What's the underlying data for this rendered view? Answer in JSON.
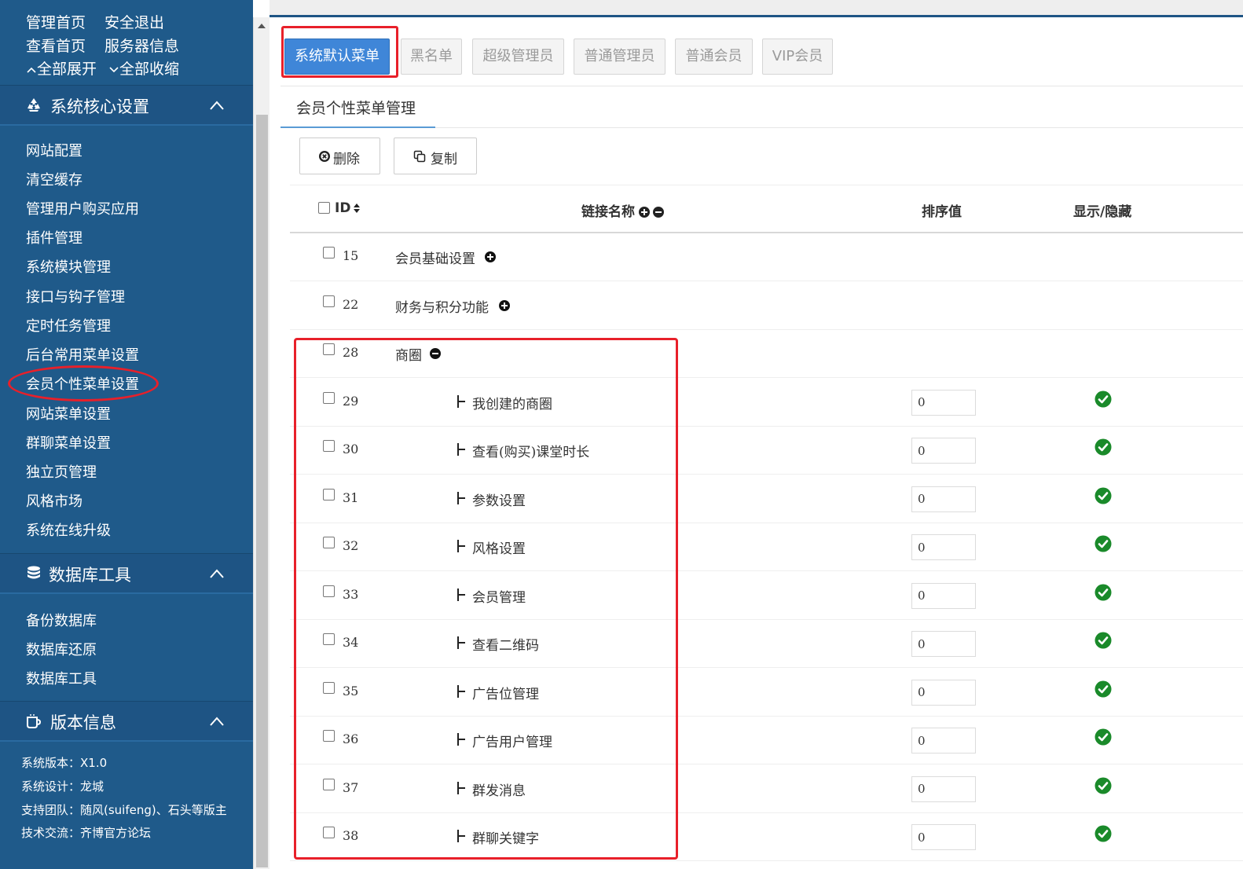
{
  "sidebar": {
    "top_links": [
      "管理首页",
      "安全退出",
      "查看首页",
      "服务器信息"
    ],
    "expand_all": "全部展开",
    "collapse_all": "全部收缩",
    "sections": [
      {
        "title": "系统核心设置",
        "icon": "recycle-icon",
        "items": [
          "网站配置",
          "清空缓存",
          "管理用户购买应用",
          "插件管理",
          "系统模块管理",
          "接口与钩子管理",
          "定时任务管理",
          "后台常用菜单设置",
          "会员个性菜单设置",
          "网站菜单设置",
          "群聊菜单设置",
          "独立页管理",
          "风格市场",
          "系统在线升级"
        ]
      },
      {
        "title": "数据库工具",
        "icon": "database-icon",
        "items": [
          "备份数据库",
          "数据库还原",
          "数据库工具"
        ]
      },
      {
        "title": "版本信息",
        "icon": "coffee-cup-icon",
        "lines": [
          "系统版本：X1.0",
          "系统设计：龙城",
          "支持团队：随风(suifeng)、石头等版主",
          "技术交流：齐博官方论坛"
        ]
      }
    ],
    "active_item": "会员个性菜单设置"
  },
  "role_tabs": [
    "系统默认菜单",
    "黑名单",
    "超级管理员",
    "普通管理员",
    "普通会员",
    "VIP会员"
  ],
  "active_tab": "系统默认菜单",
  "panel_title": "会员个性菜单管理",
  "actions": {
    "delete": "删除",
    "copy": "复制"
  },
  "table": {
    "headers": {
      "id": "ID",
      "name": "链接名称",
      "order": "排序值",
      "visibility": "显示/隐藏"
    },
    "rows": [
      {
        "id": "15",
        "name": "会员基础设置",
        "level": 0,
        "expand": "plus"
      },
      {
        "id": "22",
        "name": "财务与积分功能",
        "level": 0,
        "expand": "plus"
      },
      {
        "id": "28",
        "name": "商圈",
        "level": 0,
        "expand": "minus"
      },
      {
        "id": "29",
        "name": "我创建的商圈",
        "level": 1,
        "order": "0",
        "visible": true
      },
      {
        "id": "30",
        "name": "查看(购买)课堂时长",
        "level": 1,
        "order": "0",
        "visible": true
      },
      {
        "id": "31",
        "name": "参数设置",
        "level": 1,
        "order": "0",
        "visible": true
      },
      {
        "id": "32",
        "name": "风格设置",
        "level": 1,
        "order": "0",
        "visible": true
      },
      {
        "id": "33",
        "name": "会员管理",
        "level": 1,
        "order": "0",
        "visible": true
      },
      {
        "id": "34",
        "name": "查看二维码",
        "level": 1,
        "order": "0",
        "visible": true
      },
      {
        "id": "35",
        "name": "广告位管理",
        "level": 1,
        "order": "0",
        "visible": true
      },
      {
        "id": "36",
        "name": "广告用户管理",
        "level": 1,
        "order": "0",
        "visible": true
      },
      {
        "id": "37",
        "name": "群发消息",
        "level": 1,
        "order": "0",
        "visible": true
      },
      {
        "id": "38",
        "name": "群聊关键字",
        "level": 1,
        "order": "0",
        "visible": true
      }
    ]
  },
  "colors": {
    "sidebar_bg": "#1f5a8a",
    "accent": "#3f86d8",
    "highlight": "#e8202a",
    "check": "#1a8a2a"
  }
}
